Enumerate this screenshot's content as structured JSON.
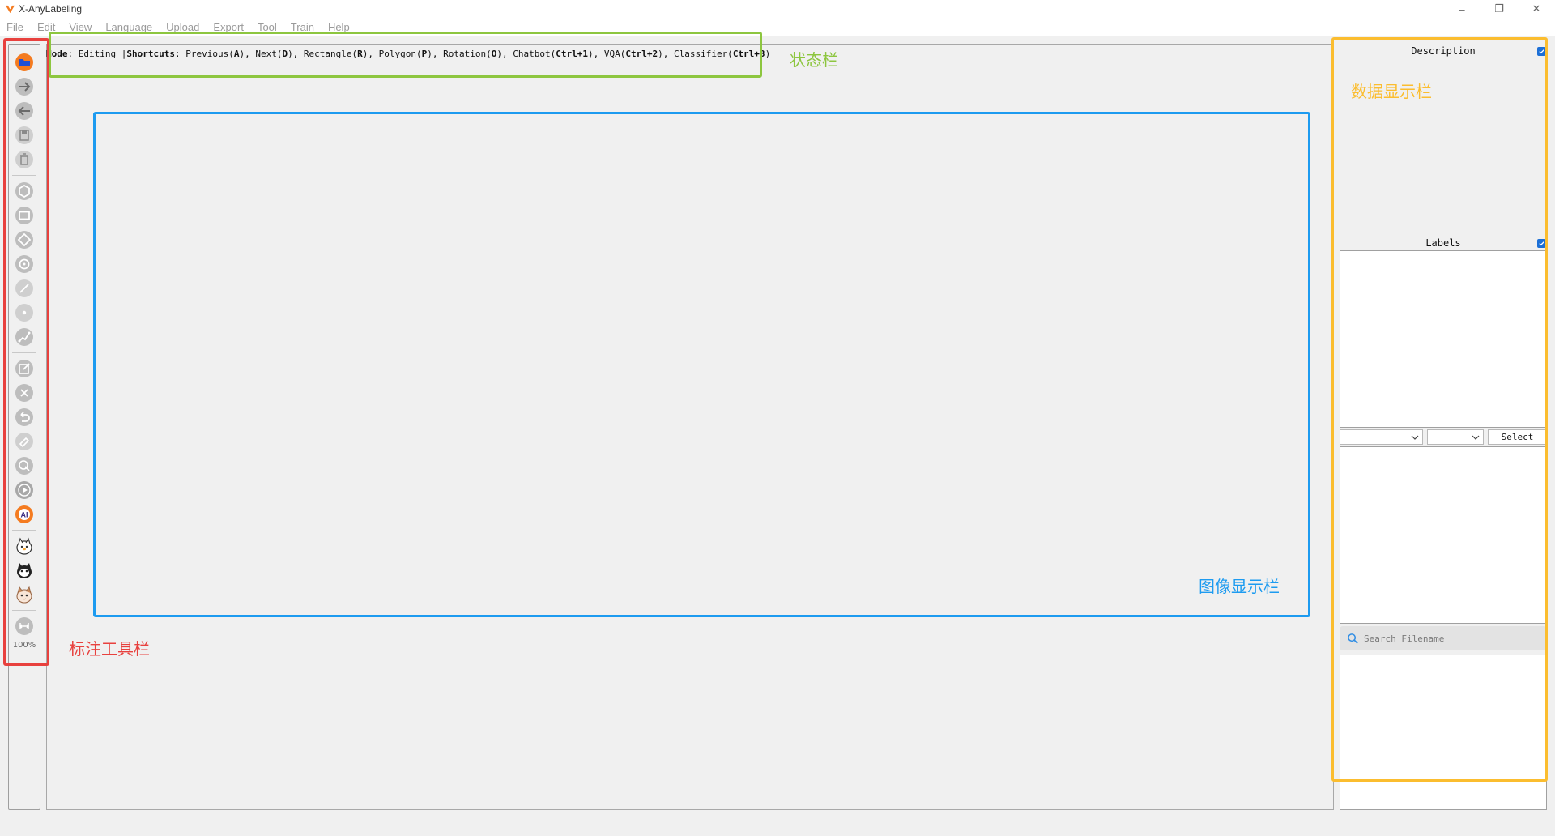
{
  "window": {
    "title": "X-AnyLabeling",
    "controls": {
      "minimize": "–",
      "maximize": "❐",
      "close": "✕"
    }
  },
  "menu": [
    "File",
    "Edit",
    "View",
    "Language",
    "Upload",
    "Export",
    "Tool",
    "Train",
    "Help"
  ],
  "toolbar": {
    "tools": [
      "open-dir",
      "next-image",
      "prev-image",
      "save",
      "delete-file",
      "polygon",
      "rectangle",
      "rotation",
      "circle",
      "line",
      "point",
      "linestrip",
      "edit",
      "delete-shape",
      "undo",
      "erase",
      "clear-hide",
      "run",
      "ai",
      "chatbot",
      "vqa",
      "classifier",
      "fit-width"
    ],
    "zoom": "100%"
  },
  "statusbar": {
    "mode_label": "Mode",
    "mode_value": ": Editing | ",
    "shortcuts_label": "Shortcuts",
    "shortcuts_text": ": Previous(",
    "k1": "A",
    "t1": "), Next(",
    "k2": "D",
    "t2": "), Rectangle(",
    "k3": "R",
    "t3": "), Polygon(",
    "k4": "P",
    "t4": "), Rotation(",
    "k5": "O",
    "t5": "), Chatbot(",
    "k6": "Ctrl+1",
    "t6": "), VQA(",
    "k7": "Ctrl+2",
    "t7": "), Classifier(",
    "k8": "Ctrl+3",
    "t8": ")"
  },
  "dock": {
    "description_title": "Description",
    "labels_title": "Labels",
    "select_button": "Select",
    "search_placeholder": "Search Filename",
    "description_checked": true,
    "labels_checked": true
  },
  "annotations": {
    "toolbar_note": "标注工具栏",
    "status_note": "状态栏",
    "image_note": "图像显示栏",
    "data_note": "数据显示栏",
    "colors": {
      "red": "#e8413e",
      "green": "#8dc63f",
      "blue": "#1d9bf0",
      "yellow": "#fbbd2f"
    }
  },
  "colors": {
    "accent": "#1c6fd6",
    "ai_orange": "#f47b20",
    "folder_blue": "#1e4fd6"
  }
}
